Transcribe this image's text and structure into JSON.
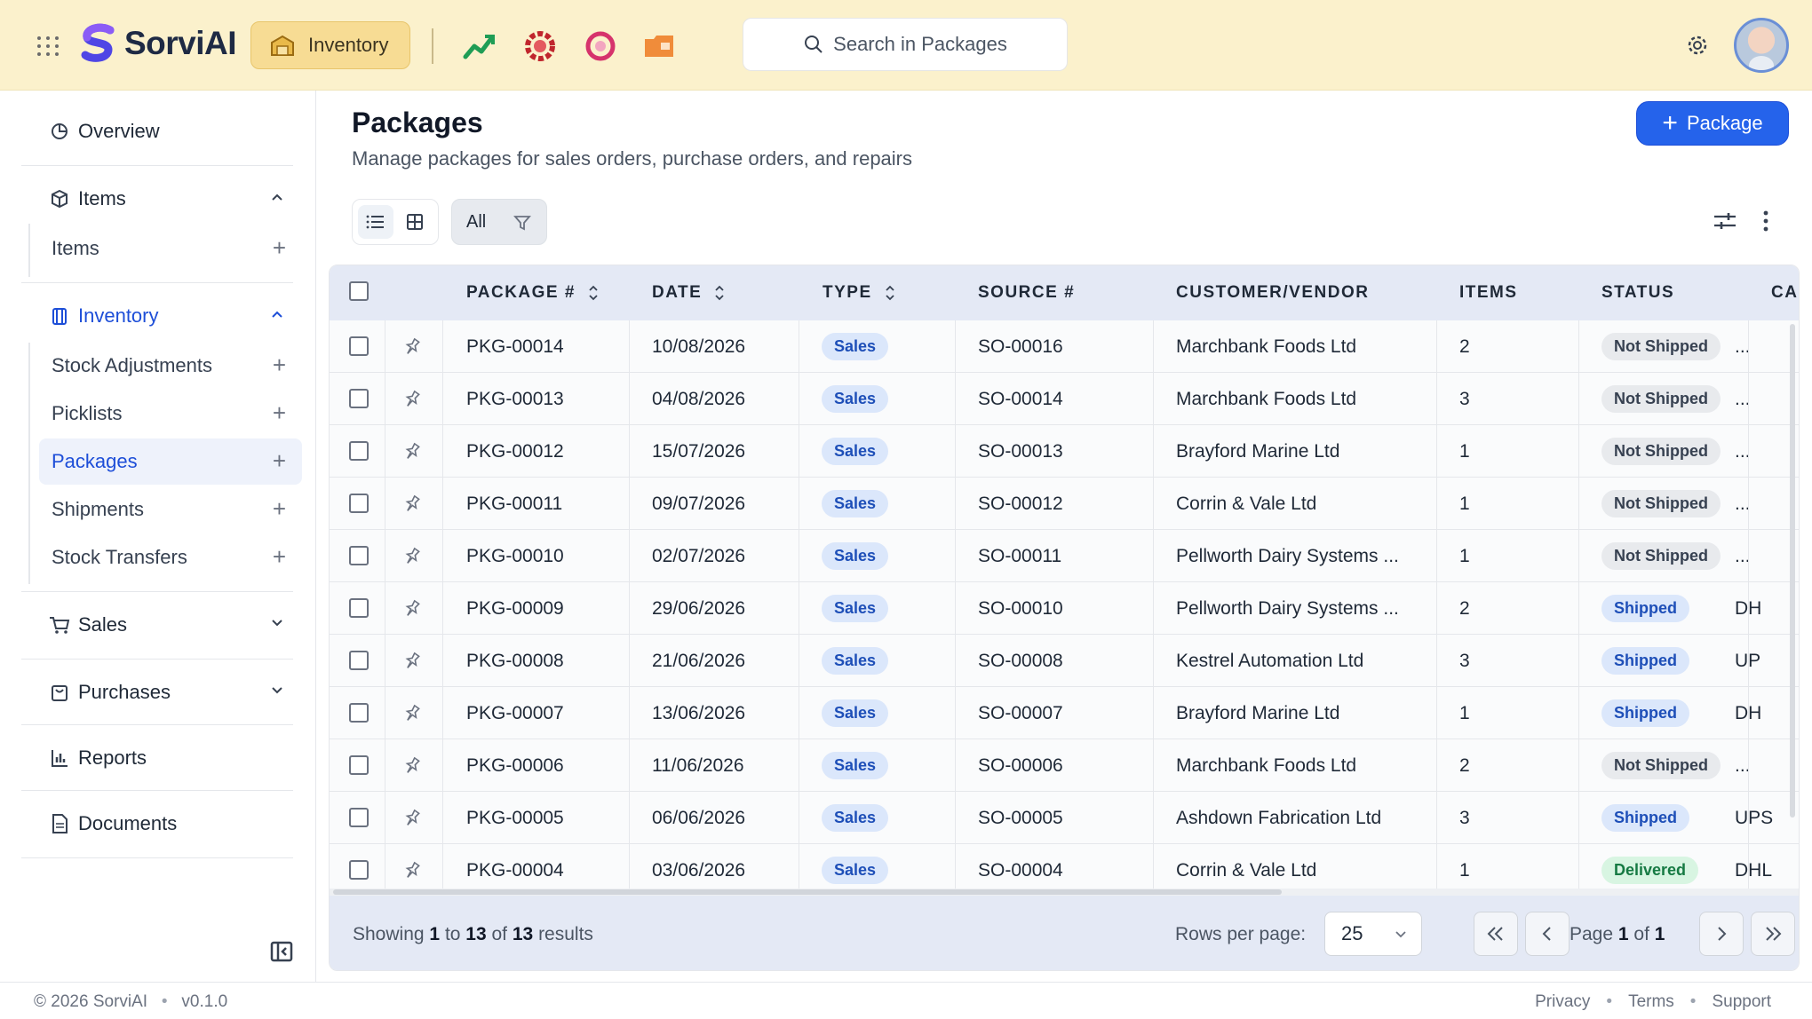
{
  "app": {
    "name": "SorviAI",
    "module": "Inventory"
  },
  "search": {
    "placeholder": "Search in Packages"
  },
  "sidebar": {
    "overview": "Overview",
    "items_group": "Items",
    "items_sub": [
      "Items"
    ],
    "inventory_group": "Inventory",
    "inventory_sub": [
      "Stock Adjustments",
      "Picklists",
      "Packages",
      "Shipments",
      "Stock Transfers"
    ],
    "sales": "Sales",
    "purchases": "Purchases",
    "reports": "Reports",
    "documents": "Documents"
  },
  "page": {
    "title": "Packages",
    "subtitle": "Manage packages for sales orders, purchase orders, and repairs",
    "add_label": "Package",
    "filter_label": "All"
  },
  "table": {
    "headers": [
      "PACKAGE #",
      "DATE",
      "TYPE",
      "SOURCE #",
      "CUSTOMER/VENDOR",
      "ITEMS",
      "STATUS",
      "CAI"
    ],
    "rows": [
      {
        "pkg": "PKG-00014",
        "date": "10/08/2026",
        "type": "Sales",
        "src": "SO-00016",
        "cust": "Marchbank Foods Ltd",
        "items": "2",
        "status": "Not Shipped",
        "carrier": "..."
      },
      {
        "pkg": "PKG-00013",
        "date": "04/08/2026",
        "type": "Sales",
        "src": "SO-00014",
        "cust": "Marchbank Foods Ltd",
        "items": "3",
        "status": "Not Shipped",
        "carrier": "..."
      },
      {
        "pkg": "PKG-00012",
        "date": "15/07/2026",
        "type": "Sales",
        "src": "SO-00013",
        "cust": "Brayford Marine Ltd",
        "items": "1",
        "status": "Not Shipped",
        "carrier": "..."
      },
      {
        "pkg": "PKG-00011",
        "date": "09/07/2026",
        "type": "Sales",
        "src": "SO-00012",
        "cust": "Corrin & Vale Ltd",
        "items": "1",
        "status": "Not Shipped",
        "carrier": "..."
      },
      {
        "pkg": "PKG-00010",
        "date": "02/07/2026",
        "type": "Sales",
        "src": "SO-00011",
        "cust": "Pellworth Dairy Systems ...",
        "items": "1",
        "status": "Not Shipped",
        "carrier": "..."
      },
      {
        "pkg": "PKG-00009",
        "date": "29/06/2026",
        "type": "Sales",
        "src": "SO-00010",
        "cust": "Pellworth Dairy Systems ...",
        "items": "2",
        "status": "Shipped",
        "carrier": "DH"
      },
      {
        "pkg": "PKG-00008",
        "date": "21/06/2026",
        "type": "Sales",
        "src": "SO-00008",
        "cust": "Kestrel Automation Ltd",
        "items": "3",
        "status": "Shipped",
        "carrier": "UP"
      },
      {
        "pkg": "PKG-00007",
        "date": "13/06/2026",
        "type": "Sales",
        "src": "SO-00007",
        "cust": "Brayford Marine Ltd",
        "items": "1",
        "status": "Shipped",
        "carrier": "DH"
      },
      {
        "pkg": "PKG-00006",
        "date": "11/06/2026",
        "type": "Sales",
        "src": "SO-00006",
        "cust": "Marchbank Foods Ltd",
        "items": "2",
        "status": "Not Shipped",
        "carrier": "..."
      },
      {
        "pkg": "PKG-00005",
        "date": "06/06/2026",
        "type": "Sales",
        "src": "SO-00005",
        "cust": "Ashdown Fabrication Ltd",
        "items": "3",
        "status": "Shipped",
        "carrier": "UPS"
      },
      {
        "pkg": "PKG-00004",
        "date": "03/06/2026",
        "type": "Sales",
        "src": "SO-00004",
        "cust": "Corrin & Vale Ltd",
        "items": "1",
        "status": "Delivered",
        "carrier": "DHL"
      }
    ]
  },
  "pagination": {
    "showing_prefix": "Showing",
    "from": "1",
    "to_word": "to",
    "to": "13",
    "of_word": "of",
    "total": "13",
    "results_word": "results",
    "rows_label": "Rows per page:",
    "rows_value": "25",
    "page_word": "Page",
    "page": "1",
    "page_of": "of",
    "pages": "1"
  },
  "footer": {
    "copyright": "© 2026 SorviAI",
    "version": "v0.1.0",
    "links": [
      "Privacy",
      "Terms",
      "Support"
    ]
  },
  "colors": {
    "topbar": "#fbf1cc",
    "accent": "#2563eb",
    "header_row": "#e4e9f5"
  }
}
